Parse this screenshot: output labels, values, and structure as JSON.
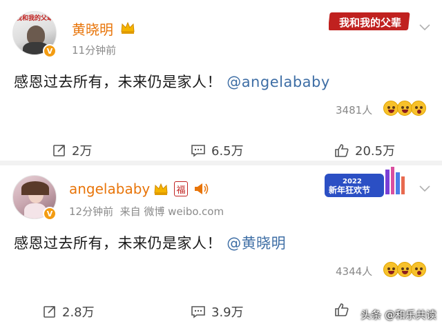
{
  "posts": [
    {
      "username": "黄晓明",
      "time": "11分钟前",
      "source": "",
      "content_text": "感恩过去所有，未来仍是家人！",
      "mention": "@angelababy",
      "likes_count": "3481人",
      "repost_count": "2万",
      "comment_count": "6.5万",
      "like_count": "20.5万",
      "avatar_caption": "我和我的父辈",
      "banner_text": "我和我的父辈"
    },
    {
      "username": "angelababy",
      "time": "12分钟前",
      "source": "来自 微博 weibo.com",
      "content_text": "感恩过去所有，未来仍是家人！",
      "mention": "@黄晓明",
      "likes_count": "4344人",
      "repost_count": "2.8万",
      "comment_count": "3.9万",
      "like_count": "",
      "badge_fu": "福",
      "banner_year": "2022",
      "banner_text": "新年狂欢节"
    }
  ],
  "watermark": "头条 @和乐共读",
  "colors": {
    "username": "#e8750a",
    "mention": "#3e6ea5",
    "verified_badge": "#f39c12",
    "banner_red": "#c0211f",
    "banner_blue": "#2b4fc4"
  },
  "icons": [
    "chevron-down-icon",
    "crown-icon",
    "verified-icon",
    "repost-icon",
    "comment-icon",
    "like-icon",
    "emoji-laugh-icon",
    "speaker-icon",
    "fu-badge-icon"
  ]
}
